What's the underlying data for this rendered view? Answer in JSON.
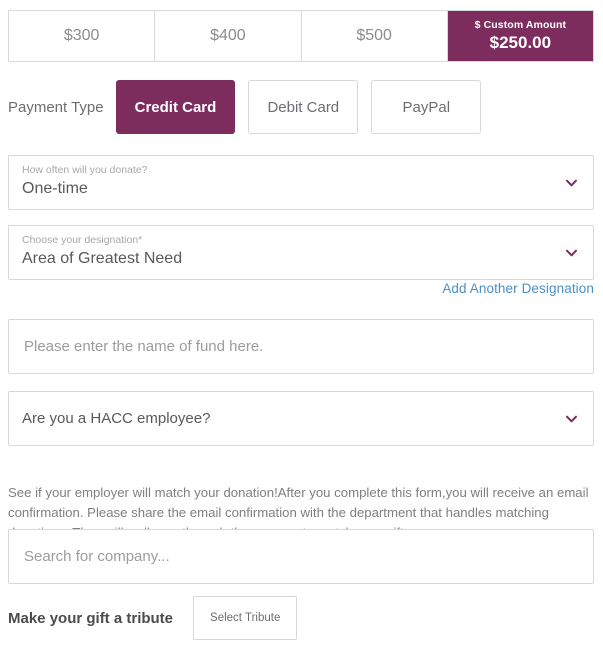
{
  "amounts": {
    "options": [
      {
        "label": "$300",
        "selected": false
      },
      {
        "label": "$400",
        "selected": false
      },
      {
        "label": "$500",
        "selected": false
      }
    ],
    "custom": {
      "label": "$ Custom Amount",
      "value": "$250.00",
      "selected": true
    }
  },
  "payment_type": {
    "label": "Payment Type",
    "options": [
      {
        "label": "Credit Card",
        "selected": true
      },
      {
        "label": "Debit Card",
        "selected": false
      },
      {
        "label": "PayPal",
        "selected": false
      }
    ]
  },
  "frequency": {
    "mini_label": "How often will you donate?",
    "value": "One-time",
    "icon": "chevron-down-icon"
  },
  "designation": {
    "mini_label": "Choose your designation",
    "required_marker": "*",
    "value": "Area of Greatest Need",
    "icon": "chevron-down-icon",
    "add_link": "Add Another Designation"
  },
  "fund_name": {
    "placeholder": "Please enter the name of fund here.",
    "value": ""
  },
  "employee_question": {
    "value": "Are you a HACC employee?",
    "icon": "chevron-down-icon"
  },
  "employer_match": {
    "text": "See if your employer will match your donation!After you complete this form,you will receive an email confirmation. Please share the email confirmation with the department that handles matching donations. They will walk you through the process to match your gift.",
    "search": {
      "placeholder": "Search for company...",
      "value": ""
    }
  },
  "tribute": {
    "label": "Make your gift a tribute",
    "button_label": "Select Tribute"
  },
  "colors": {
    "brand_purple": "#7d2c5e",
    "link_blue": "#4a90c4",
    "border_gray": "#d8d8d8",
    "text_gray": "#6d6e71",
    "placeholder_gray": "#9a9c9e"
  }
}
